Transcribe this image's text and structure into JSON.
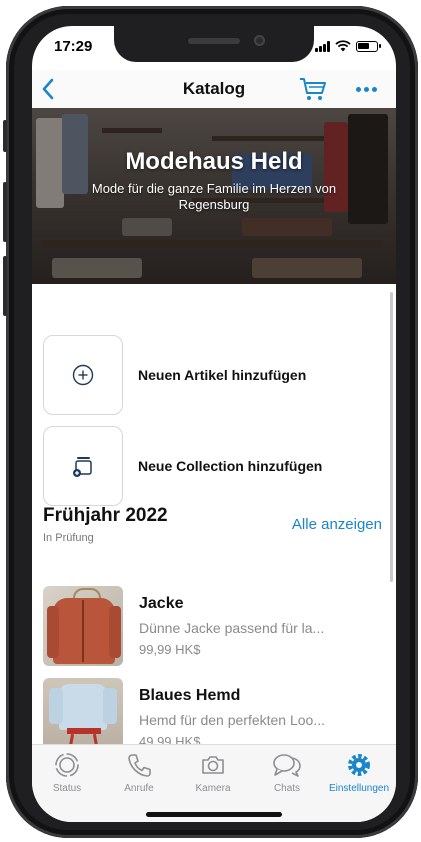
{
  "status_bar": {
    "time": "17:29"
  },
  "nav": {
    "back_icon": "chevron-left-icon",
    "title": "Katalog",
    "cart_icon": "cart-icon",
    "more_icon": "more-dots-icon"
  },
  "hero": {
    "title": "Modehaus Held",
    "subtitle": "Mode für die ganze Familie im Herzen von Regensburg"
  },
  "actions": [
    {
      "label": "Neuen Artikel hinzufügen",
      "icon": "plus-circle-icon"
    },
    {
      "label": "Neue Collection hinzufügen",
      "icon": "add-collection-icon"
    }
  ],
  "collection": {
    "title": "Frühjahr 2022",
    "status": "In Prüfung",
    "link": "Alle anzeigen",
    "products": [
      {
        "name": "Jacke",
        "description": "Dünne Jacke passend für la...",
        "price": "99,99 HK$"
      },
      {
        "name": "Blaues Hemd",
        "description": "Hemd für den perfekten Loo...",
        "price": "49,99 HK$"
      }
    ]
  },
  "tabs": [
    {
      "label": "Status",
      "icon": "status-icon"
    },
    {
      "label": "Anrufe",
      "icon": "phone-icon"
    },
    {
      "label": "Kamera",
      "icon": "camera-icon"
    },
    {
      "label": "Chats",
      "icon": "chat-bubbles-icon"
    },
    {
      "label": "Einstellungen",
      "icon": "settings-gear-icon"
    }
  ],
  "colors": {
    "accent": "#1a86c8",
    "tab_inactive": "#8e8e93",
    "frame": "#1f1f21"
  }
}
